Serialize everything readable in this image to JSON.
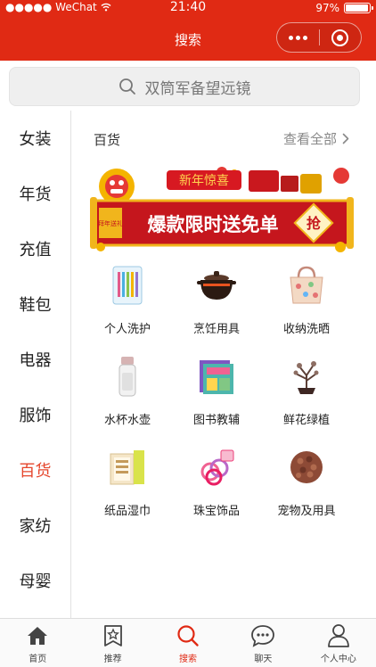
{
  "status_bar": {
    "carrier": "●●●●● WeChat",
    "time": "21:40",
    "battery": "97%",
    "battery_level": 0.97
  },
  "nav": {
    "title": "搜索"
  },
  "search": {
    "placeholder": "双筒军备望远镜"
  },
  "sidebar": {
    "items": [
      {
        "label": "女装",
        "active": false
      },
      {
        "label": "年货",
        "active": false
      },
      {
        "label": "充值",
        "active": false
      },
      {
        "label": "鞋包",
        "active": false
      },
      {
        "label": "电器",
        "active": false
      },
      {
        "label": "服饰",
        "active": false
      },
      {
        "label": "百货",
        "active": true
      },
      {
        "label": "家纺",
        "active": false
      },
      {
        "label": "母婴",
        "active": false
      }
    ]
  },
  "section": {
    "title": "百货",
    "see_all": "查看全部",
    "banner": {
      "headline": "新年惊喜",
      "main": "爆款限时送免单",
      "badge": "抢",
      "scroll": "拜年送礼"
    },
    "grid": [
      {
        "label": "个人洗护",
        "icon": "toothbrush-pack-icon"
      },
      {
        "label": "烹饪用具",
        "icon": "clay-pot-icon"
      },
      {
        "label": "收纳洗晒",
        "icon": "storage-bag-icon"
      },
      {
        "label": "水杯水壶",
        "icon": "water-bottle-icon"
      },
      {
        "label": "图书教辅",
        "icon": "books-icon"
      },
      {
        "label": "鲜花绿植",
        "icon": "bonsai-icon"
      },
      {
        "label": "纸品湿巾",
        "icon": "tissue-pack-icon"
      },
      {
        "label": "珠宝饰品",
        "icon": "hair-ties-icon"
      },
      {
        "label": "宠物及用具",
        "icon": "pet-food-icon"
      }
    ]
  },
  "tabbar": [
    {
      "label": "首页",
      "icon": "home-icon",
      "active": false
    },
    {
      "label": "推荐",
      "icon": "recommend-icon",
      "active": false
    },
    {
      "label": "搜索",
      "icon": "search-icon",
      "active": true
    },
    {
      "label": "聊天",
      "icon": "chat-icon",
      "active": false
    },
    {
      "label": "个人中心",
      "icon": "user-icon",
      "active": false
    }
  ],
  "colors": {
    "brand_red": "#e02a14",
    "active_text": "#e5462c"
  }
}
